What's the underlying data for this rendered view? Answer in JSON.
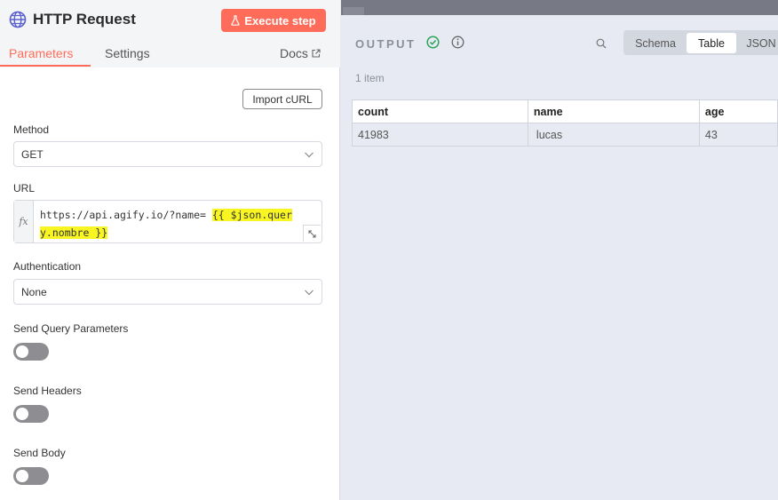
{
  "node": {
    "title": "HTTP Request",
    "execute_label": "Execute step",
    "icon": "globe-icon"
  },
  "tabs": {
    "parameters": "Parameters",
    "settings": "Settings",
    "docs": "Docs"
  },
  "import_curl_label": "Import cURL",
  "method": {
    "label": "Method",
    "value": "GET"
  },
  "url": {
    "label": "URL",
    "fx": "fx",
    "prefix": "https://api.agify.io/?name= ",
    "expr_part1": "{{ $json.quer",
    "expr_part2": "y.nombre }}"
  },
  "authentication": {
    "label": "Authentication",
    "value": "None"
  },
  "toggles": {
    "query": "Send Query Parameters",
    "headers": "Send Headers",
    "body": "Send Body"
  },
  "output": {
    "label": "OUTPUT",
    "item_count": "1 item",
    "views": [
      "Schema",
      "Table",
      "JSON"
    ],
    "columns": [
      "count",
      "name",
      "age"
    ],
    "rows": [
      [
        "41983",
        "lucas",
        "43"
      ]
    ]
  },
  "colors": {
    "accent": "#ff6d5a",
    "highlight": "#f8f522",
    "success": "#29a35a"
  }
}
